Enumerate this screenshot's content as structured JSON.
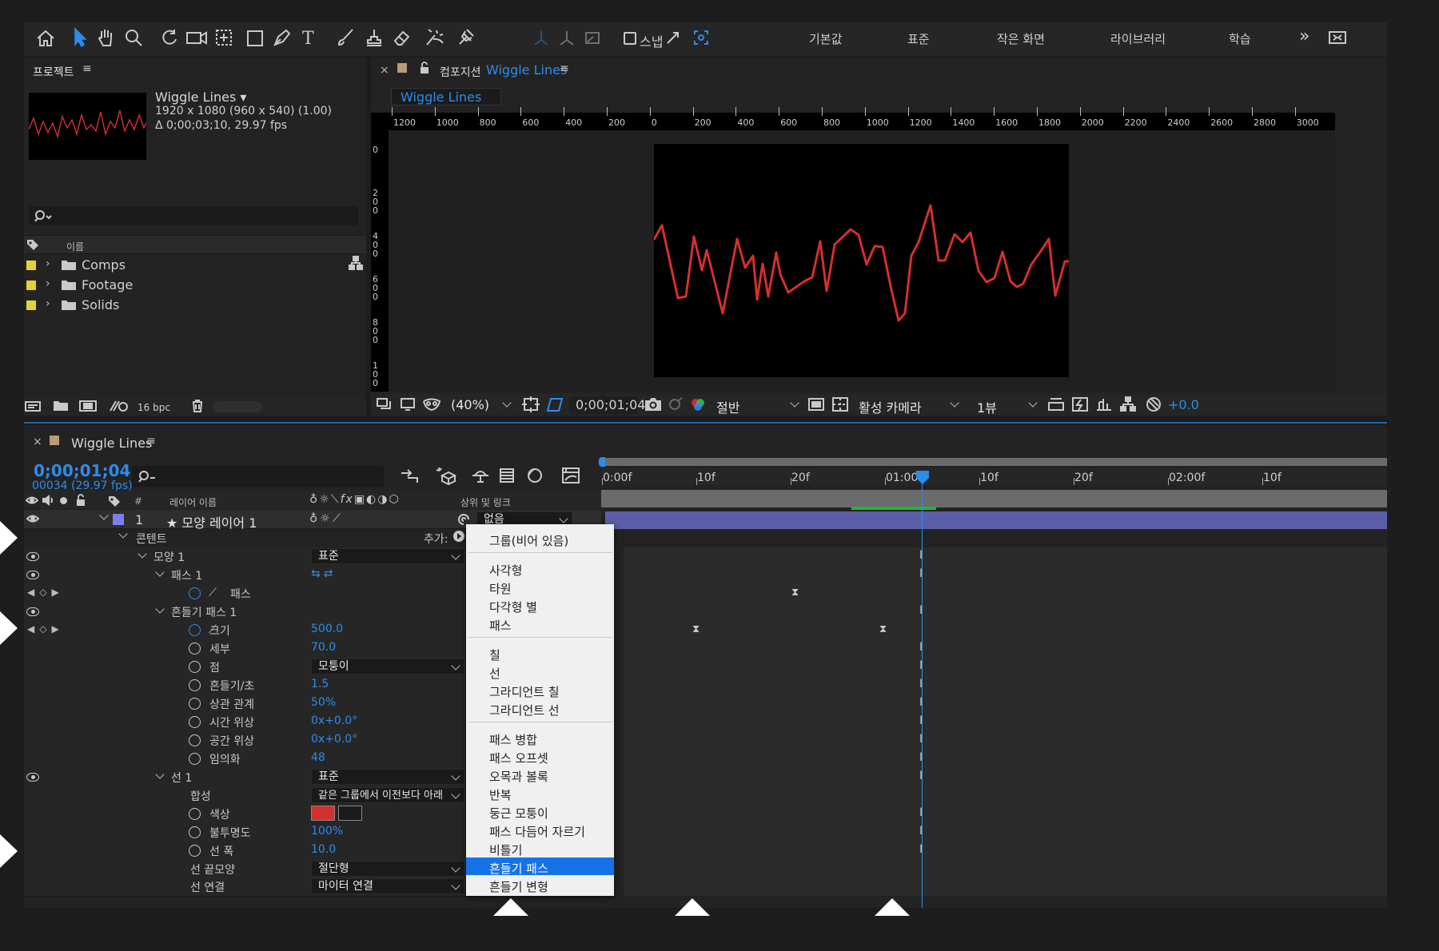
{
  "toolbar": {
    "workspaces": [
      "기본값",
      "표준",
      "작은 화면",
      "라이브러리",
      "학습"
    ],
    "snap_label": "스냅",
    "overflow": "»"
  },
  "project": {
    "title": "프로젝트",
    "comp_name": "Wiggle Lines ▾",
    "comp_info1": "1920 x 1080  (960 x 540) (1.00)",
    "comp_info2": "Δ 0;00;03;10, 29.97 fps",
    "col_name": "이름",
    "items": [
      {
        "label": "Comps"
      },
      {
        "label": "Footage"
      },
      {
        "label": "Solids"
      }
    ],
    "bpc": "16 bpc"
  },
  "comp": {
    "prefix": "컴포지션",
    "name": "Wiggle Lines",
    "tab": "Wiggle Lines",
    "zoom": "(40%)",
    "time": "0;00;01;04",
    "resolution": "절반",
    "camera": "활성 카메라",
    "views": "1뷰",
    "exposure": "+0.0",
    "ruler_h": [
      "1200",
      "1000",
      "800",
      "600",
      "400",
      "200",
      "0",
      "200",
      "400",
      "600",
      "800",
      "1000",
      "1200",
      "1400",
      "1600",
      "1800",
      "2000",
      "2200",
      "2400",
      "2600",
      "2800",
      "3000"
    ],
    "ruler_v": [
      "0",
      "200",
      "400",
      "600",
      "800",
      "100"
    ]
  },
  "timeline": {
    "title": "Wiggle Lines",
    "timecode": "0;00;01;04",
    "frames": "00034 (29.97 fps)",
    "col_layer_name": "레이어 이름",
    "col_num": "#",
    "col_parent": "상위 및 링크",
    "ticks": [
      "0:00f",
      "10f",
      "20f",
      "01:00f",
      "10f",
      "20f",
      "02:00f",
      "10f"
    ],
    "layer": {
      "num": "1",
      "name": "★ 모양 레이어 1",
      "parent": "없음"
    },
    "contents": "콘텐트",
    "add": "추가:",
    "props": [
      {
        "label": "모양 1",
        "value": "표준"
      },
      {
        "label": "패스 1"
      },
      {
        "label": "패스"
      },
      {
        "label": "흔들기 패스 1"
      },
      {
        "label": "크기",
        "value": "500.0"
      },
      {
        "label": "세부",
        "value": "70.0"
      },
      {
        "label": "점",
        "value": "모퉁이"
      },
      {
        "label": "흔들기/초",
        "value": "1.5"
      },
      {
        "label": "상관 관계",
        "value": "50%"
      },
      {
        "label": "시간 위상",
        "value": "0x+0.0°"
      },
      {
        "label": "공간 위상",
        "value": "0x+0.0°"
      },
      {
        "label": "임의화",
        "value": "48"
      },
      {
        "label": "선 1",
        "value": "표준"
      },
      {
        "label": "합성",
        "value": "같은 그룹에서 이전보다 아래"
      },
      {
        "label": "색상"
      },
      {
        "label": "불투명도",
        "value": "100%"
      },
      {
        "label": "선 폭",
        "value": "10.0"
      },
      {
        "label": "선 끝모양",
        "value": "절단형"
      },
      {
        "label": "선 연결",
        "value": "마이터 연결"
      }
    ]
  },
  "menu": {
    "groups": [
      [
        "그룹(비어 있음)"
      ],
      [
        "사각형",
        "타원",
        "다각형 별",
        "패스"
      ],
      [
        "칠",
        "선",
        "그라디언트 칠",
        "그라디언트 선"
      ],
      [
        "패스 병합",
        "패스 오프셋",
        "오목과 볼록",
        "반복",
        "둥근 모퉁이",
        "패스 다듬어 자르기",
        "비틀기",
        "흔들기 패스",
        "흔들기 변형"
      ]
    ],
    "selected": "흔들기 패스"
  },
  "colors": {
    "accent": "#2d8ceb",
    "menu_highlight": "#1473e6",
    "wave": "#d2302d",
    "label_yellow": "#e3d13a",
    "layer_purple": "#7b7ff2",
    "layer_bar": "#5c5fa8",
    "work_area": "#1fb83d"
  }
}
